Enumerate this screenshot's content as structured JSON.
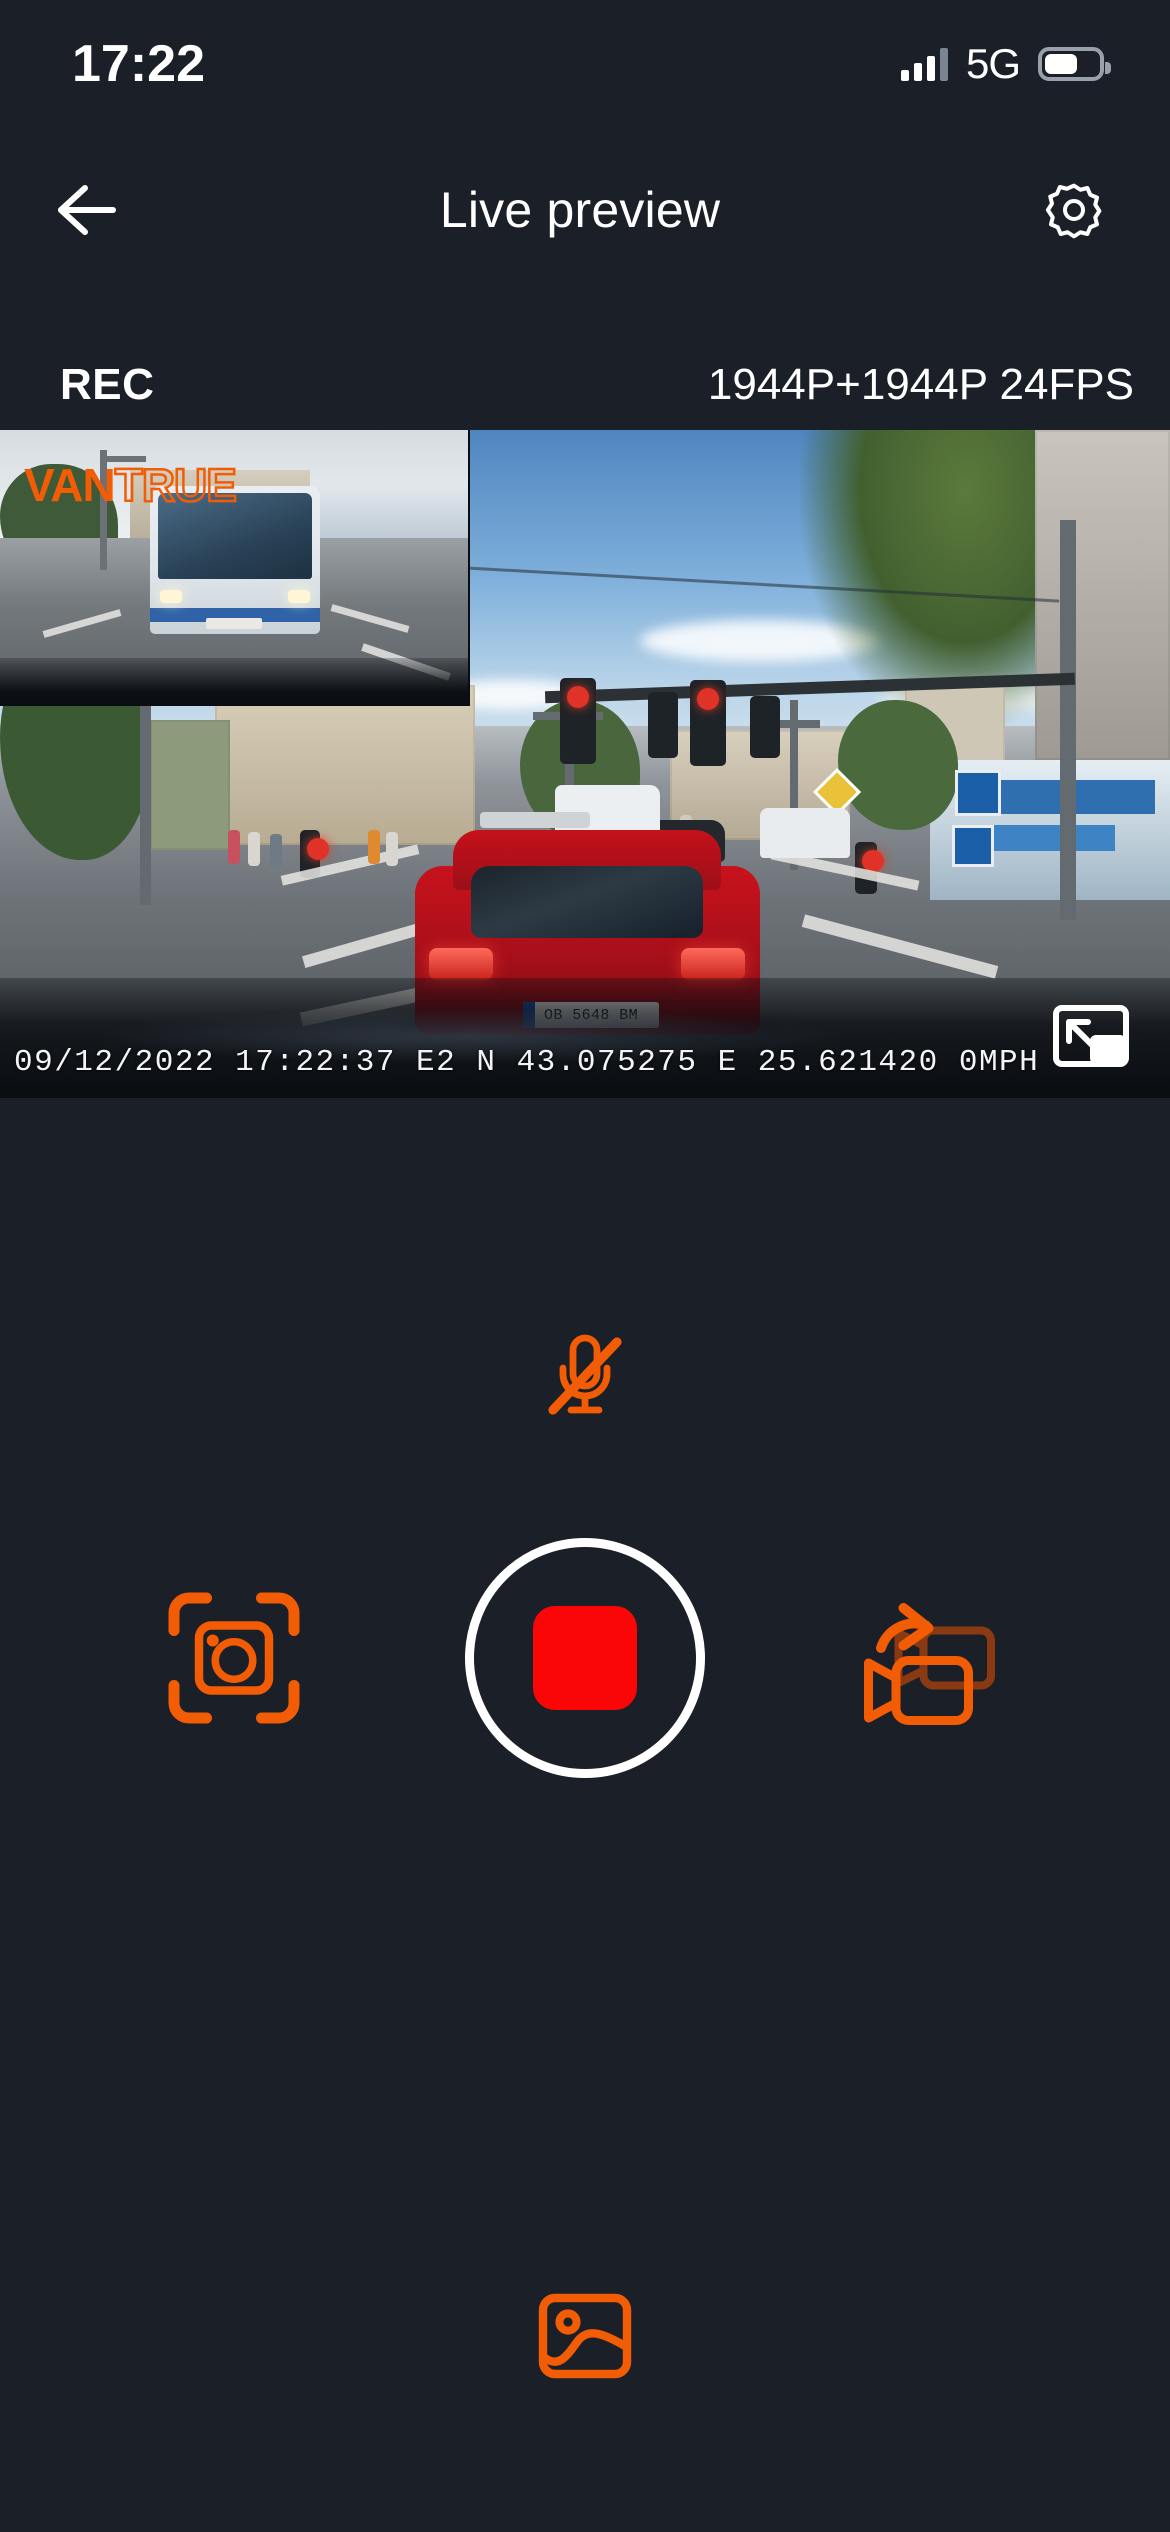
{
  "status_bar": {
    "time": "17:22",
    "network": "5G",
    "signal_icon": "signal-bars-icon",
    "battery_icon": "battery-icon",
    "battery_level_percent": 62
  },
  "nav_bar": {
    "back_icon": "arrow-left-icon",
    "title": "Live preview",
    "settings_icon": "gear-icon"
  },
  "stream_info": {
    "rec_label": "REC",
    "resolution": "1944P+1944P 24FPS"
  },
  "video": {
    "osd_overlay": "09/12/2022  17:22:37 E2  N 43.075275  E 25.621420  0MPH",
    "watermark_solid": "VAN",
    "watermark_outline": "TRUE",
    "pip_toggle_icon": "picture-in-picture-swap-icon",
    "license_plate": "OB 5648 BM"
  },
  "controls": {
    "mic_icon": "microphone-muted-icon",
    "snapshot_icon": "camera-snapshot-icon",
    "record_icon": "stop-record-icon",
    "camera_switch_icon": "camera-switch-icon",
    "gallery_icon": "gallery-image-icon"
  },
  "colors": {
    "background": "#1b1f28",
    "accent_orange": "#f25c05",
    "record_red": "#fb0606",
    "text_primary": "#ffffff"
  }
}
